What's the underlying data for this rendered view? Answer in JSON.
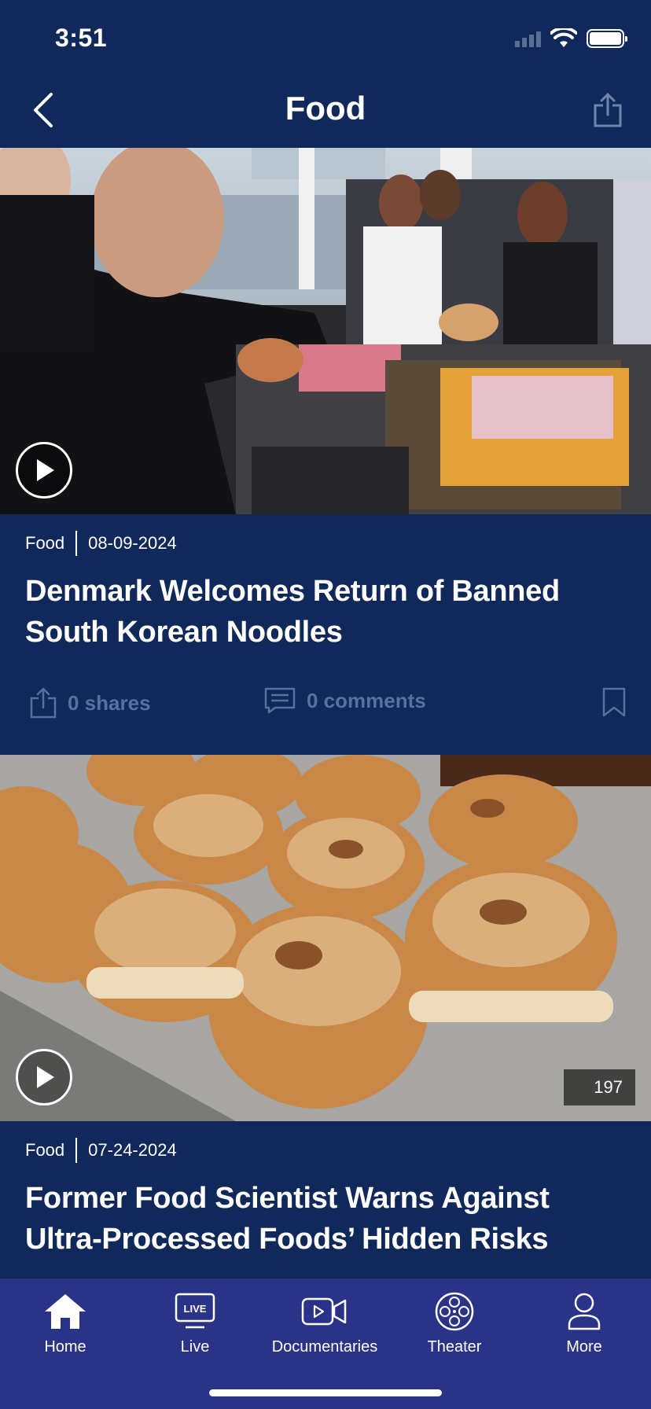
{
  "status_bar": {
    "time": "3:51"
  },
  "header": {
    "title": "Food"
  },
  "articles": [
    {
      "category": "Food",
      "date": "08-09-2024",
      "headline": "Denmark Welcomes Return of Banned South Korean Noodles",
      "shares": "0 shares",
      "comments": "0 comments"
    },
    {
      "category": "Food",
      "date": "07-24-2024",
      "headline": "Former Food Scientist Warns Against Ultra-Processed Foods’ Hidden Risks",
      "duration": "197"
    }
  ],
  "tabs": [
    {
      "label": "Home",
      "icon": "home-icon"
    },
    {
      "label": "Live",
      "icon": "live-tv-icon",
      "badge": "LIVE"
    },
    {
      "label": "Documentaries",
      "icon": "video-camera-icon"
    },
    {
      "label": "Theater",
      "icon": "film-reel-icon"
    },
    {
      "label": "More",
      "icon": "user-icon"
    }
  ],
  "colors": {
    "background": "#10295a",
    "tab_bar": "#2a3388",
    "muted": "#58709b"
  }
}
